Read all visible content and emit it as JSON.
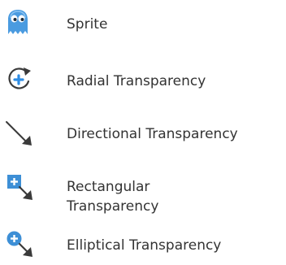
{
  "menu": {
    "items": [
      {
        "label": "Sprite",
        "icon": "ghost-sprite-icon"
      },
      {
        "label": "Radial Transparency",
        "icon": "radial-arrow-icon"
      },
      {
        "label": "Directional Transparency",
        "icon": "diagonal-arrow-icon"
      },
      {
        "label": "Rectangular Transparency",
        "icon": "rectangle-arrow-icon"
      },
      {
        "label": "Elliptical Transparency",
        "icon": "ellipse-arrow-icon"
      }
    ]
  },
  "colors": {
    "icon_blue": "#3d8fd6",
    "icon_dark": "#3a3a3a",
    "text": "#333333"
  }
}
